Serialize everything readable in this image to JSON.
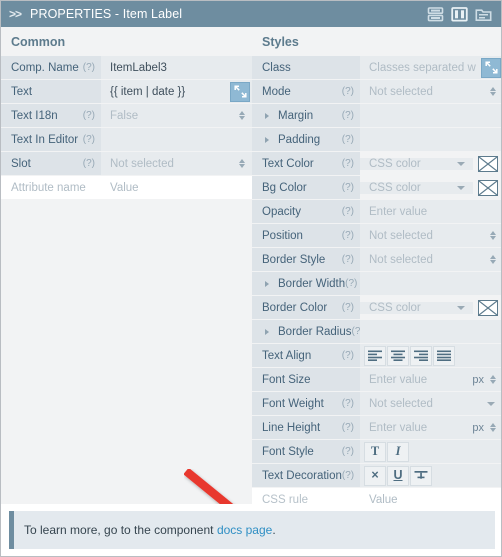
{
  "titlebar": {
    "chevron": ">>",
    "title": "PROPERTIES - Item Label",
    "icons": [
      "rows-layout-icon",
      "columns-layout-icon",
      "folder-icon"
    ],
    "bg_color": "#6e8da0"
  },
  "common": {
    "heading": "Common",
    "rows": [
      {
        "label": "Comp. Name",
        "help": "(?)",
        "value": "ItemLabel3",
        "placeholder": "",
        "control": "text"
      },
      {
        "label": "Text",
        "help": "",
        "value": "{{ item | date }}",
        "placeholder": "",
        "control": "text-expand"
      },
      {
        "label": "Text I18n",
        "help": "(?)",
        "value": "",
        "placeholder": "False",
        "control": "spinner-select"
      },
      {
        "label": "Text In Editor",
        "help": "(?)",
        "value": "",
        "placeholder": "",
        "control": "text"
      },
      {
        "label": "Slot",
        "help": "(?)",
        "value": "",
        "placeholder": "Not selected",
        "control": "spinner-select"
      },
      {
        "label": "",
        "help": "",
        "value": "",
        "placeholder": "Attribute name",
        "fieldPlaceholder": "Value",
        "control": "attribute-pair"
      }
    ]
  },
  "styles": {
    "heading": "Styles",
    "rows": [
      {
        "label": "Class",
        "help": "",
        "value": "",
        "placeholder": "Classes separated w",
        "control": "text-expand"
      },
      {
        "label": "Mode",
        "help": "(?)",
        "value": "",
        "placeholder": "Not selected",
        "control": "spinner-select"
      },
      {
        "label": "Margin",
        "help": "(?)",
        "value": "",
        "placeholder": "",
        "control": "group",
        "expandable": true
      },
      {
        "label": "Padding",
        "help": "(?)",
        "value": "",
        "placeholder": "",
        "control": "group",
        "expandable": true
      },
      {
        "label": "Text Color",
        "help": "(?)",
        "value": "",
        "placeholder": "CSS color",
        "control": "color"
      },
      {
        "label": "Bg Color",
        "help": "(?)",
        "value": "",
        "placeholder": "CSS color",
        "control": "color"
      },
      {
        "label": "Opacity",
        "help": "(?)",
        "value": "",
        "placeholder": "Enter value",
        "control": "text"
      },
      {
        "label": "Position",
        "help": "(?)",
        "value": "",
        "placeholder": "Not selected",
        "control": "spinner-select"
      },
      {
        "label": "Border Style",
        "help": "(?)",
        "value": "",
        "placeholder": "Not selected",
        "control": "spinner-select"
      },
      {
        "label": "Border Width",
        "help": "(?)",
        "value": "",
        "placeholder": "",
        "control": "group",
        "expandable": true
      },
      {
        "label": "Border Color",
        "help": "(?)",
        "value": "",
        "placeholder": "CSS color",
        "control": "color"
      },
      {
        "label": "Border Radius",
        "help": "(?)",
        "value": "",
        "placeholder": "",
        "control": "group",
        "expandable": true
      },
      {
        "label": "Text Align",
        "help": "(?)",
        "value": "",
        "placeholder": "",
        "control": "align-buttons"
      },
      {
        "label": "Font Size",
        "help": "",
        "value": "",
        "placeholder": "Enter value",
        "unit": "px",
        "control": "number-unit"
      },
      {
        "label": "Font Weight",
        "help": "(?)",
        "value": "",
        "placeholder": "Not selected",
        "control": "dropdown"
      },
      {
        "label": "Line Height",
        "help": "(?)",
        "value": "",
        "placeholder": "Enter value",
        "unit": "px",
        "control": "number-unit"
      },
      {
        "label": "Font Style",
        "help": "(?)",
        "value": "",
        "placeholder": "",
        "control": "fontstyle-buttons"
      },
      {
        "label": "Text Decoration",
        "help": "(?)",
        "value": "",
        "placeholder": "",
        "control": "decoration-buttons"
      },
      {
        "label": "",
        "help": "",
        "value": "",
        "placeholder": "CSS rule",
        "fieldPlaceholder": "Value",
        "control": "css-rule-pair"
      }
    ],
    "align_buttons": [
      "align-left-icon",
      "align-center-icon",
      "align-right-icon",
      "align-justify-icon"
    ],
    "font_style_buttons": [
      "bold-icon",
      "italic-icon"
    ],
    "decoration_buttons": [
      "none-icon",
      "underline-icon",
      "line-through-icon"
    ]
  },
  "annotation": {
    "type": "red-arrow",
    "color": "#e8382f",
    "points_to": "CSS rule"
  },
  "footer": {
    "text": "To learn more, go to the component",
    "link": "docs page",
    "suffix": ".",
    "link_color": "#2f8fc4"
  }
}
